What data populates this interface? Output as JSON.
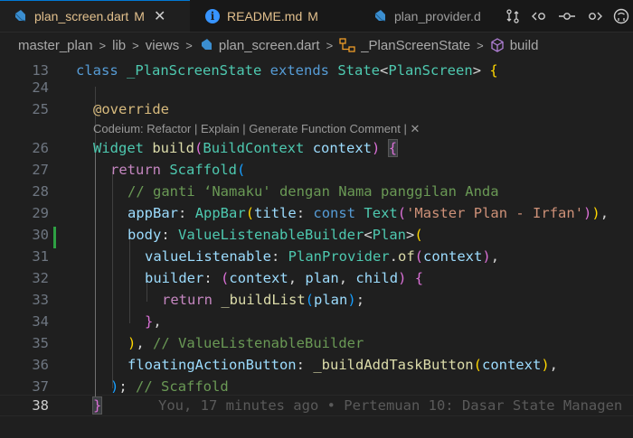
{
  "tabs": [
    {
      "label": "plan_screen.dart",
      "status": "M",
      "active": true,
      "icon": "dart-icon"
    },
    {
      "label": "README.md",
      "status": "M",
      "active": false,
      "icon": "info-icon"
    },
    {
      "label": "plan_provider.d",
      "status": "",
      "active": false,
      "icon": "dart-icon"
    }
  ],
  "breadcrumb": {
    "items": [
      "master_plan",
      "lib",
      "views",
      "plan_screen.dart",
      "_PlanScreenState",
      "build"
    ]
  },
  "codelens": {
    "text": "Codeium: Refactor | Explain | Generate Function Comment | ✕"
  },
  "line_numbers": [
    "13",
    "24",
    "25",
    "26",
    "27",
    "28",
    "29",
    "30",
    "31",
    "32",
    "33",
    "34",
    "35",
    "36",
    "37",
    "38"
  ],
  "current_line": "38",
  "blame": "You, 17 minutes ago • Pertemuan 10: Dasar State Managen",
  "code": {
    "l13": [
      "class",
      "_PlanScreenState",
      "extends",
      "State",
      "<",
      "PlanScreen",
      ">",
      "{"
    ],
    "l25": "@override",
    "l26": [
      "Widget",
      "build",
      "(",
      "BuildContext",
      "context",
      ")",
      "{"
    ],
    "l27": [
      "return",
      "Scaffold",
      "("
    ],
    "l28": "// ganti ‘Namaku' dengan Nama panggilan Anda",
    "l29": [
      "appBar",
      ":",
      "AppBar",
      "(",
      "title",
      ":",
      "const",
      "Text",
      "(",
      "'Master Plan - Irfan'",
      ")",
      ")",
      ","
    ],
    "l30": [
      "body",
      ":",
      "ValueListenableBuilder",
      "<",
      "Plan",
      ">",
      "("
    ],
    "l31": [
      "valueListenable",
      ":",
      "PlanProvider",
      ".",
      "of",
      "(",
      "context",
      ")",
      ","
    ],
    "l32": [
      "builder",
      ":",
      "(",
      "context",
      ",",
      "plan",
      ",",
      "child",
      ")",
      "{"
    ],
    "l33": [
      "return",
      "_buildList",
      "(",
      "plan",
      ")",
      ";"
    ],
    "l34": [
      "}",
      ","
    ],
    "l35": [
      ")",
      ",",
      "// ValueListenableBuilder"
    ],
    "l36": [
      "floatingActionButton",
      ":",
      "_buildAddTaskButton",
      "(",
      "context",
      ")",
      ","
    ],
    "l37": [
      ")",
      ";",
      "// Scaffold"
    ],
    "l38": "}"
  },
  "colors": {
    "accent": "#0078d4",
    "modified": "#e2c08d",
    "git_added": "#2ea043"
  }
}
